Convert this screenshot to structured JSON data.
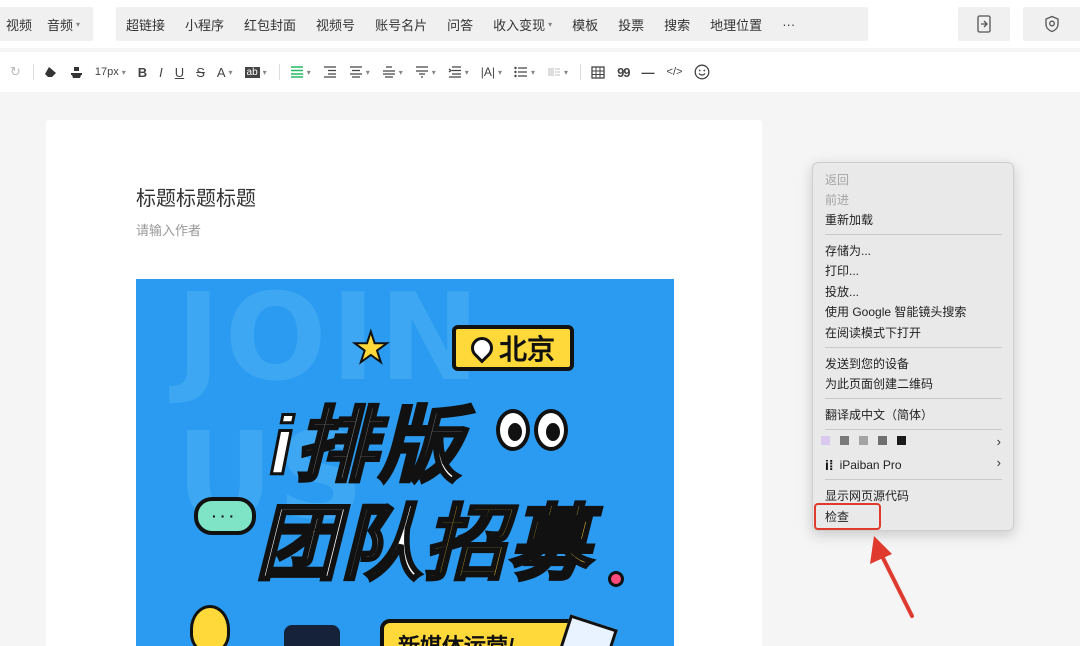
{
  "topbar": {
    "group_a": [
      {
        "label": "视频",
        "caret": false
      },
      {
        "label": "音频",
        "caret": true
      }
    ],
    "group_b": [
      {
        "label": "超链接",
        "caret": false
      },
      {
        "label": "小程序",
        "caret": false
      },
      {
        "label": "红包封面",
        "caret": false
      },
      {
        "label": "视频号",
        "caret": false
      },
      {
        "label": "账号名片",
        "caret": false
      },
      {
        "label": "问答",
        "caret": false
      },
      {
        "label": "收入变现",
        "caret": true
      },
      {
        "label": "模板",
        "caret": false
      },
      {
        "label": "投票",
        "caret": false
      },
      {
        "label": "搜索",
        "caret": false
      },
      {
        "label": "地理位置",
        "caret": false
      },
      {
        "label": "···",
        "caret": false
      }
    ]
  },
  "toolbar": {
    "font_size": "17px",
    "bold": "B",
    "italic": "I",
    "underline": "U",
    "strike": "S",
    "font_color": "A",
    "bg_color": "ab",
    "quote": "99",
    "code": "</>"
  },
  "editor": {
    "title": "标题标题标题",
    "author_placeholder": "请输入作者"
  },
  "poster": {
    "bg_text": "JOIN US",
    "location": "北京",
    "headline_1": "i排版",
    "headline_2a": "团队",
    "headline_2b": "招募",
    "bubble_text": "···",
    "banner": "新媒体运营/"
  },
  "context_menu": {
    "back": "返回",
    "forward": "前进",
    "reload": "重新加载",
    "save_as": "存储为...",
    "print": "打印...",
    "cast": "投放...",
    "google_lens": "使用 Google 智能镜头搜索",
    "reader_mode": "在阅读模式下打开",
    "send_to_devices": "发送到您的设备",
    "qr_code": "为此页面创建二维码",
    "translate": "翻译成中文（简体）",
    "extension": "iPaiban Pro",
    "view_source": "显示网页源代码",
    "inspect": "检查"
  },
  "colors": {
    "accent_highlight": "#e03a2f",
    "poster_blue": "#2a9bf0",
    "poster_yellow": "#ffd93a",
    "green_align": "#25b864",
    "swatches": [
      "#d9c9ef",
      "#7a7a7a",
      "#a3a3a3",
      "#6f6f6f",
      "#1a1a1a"
    ]
  }
}
